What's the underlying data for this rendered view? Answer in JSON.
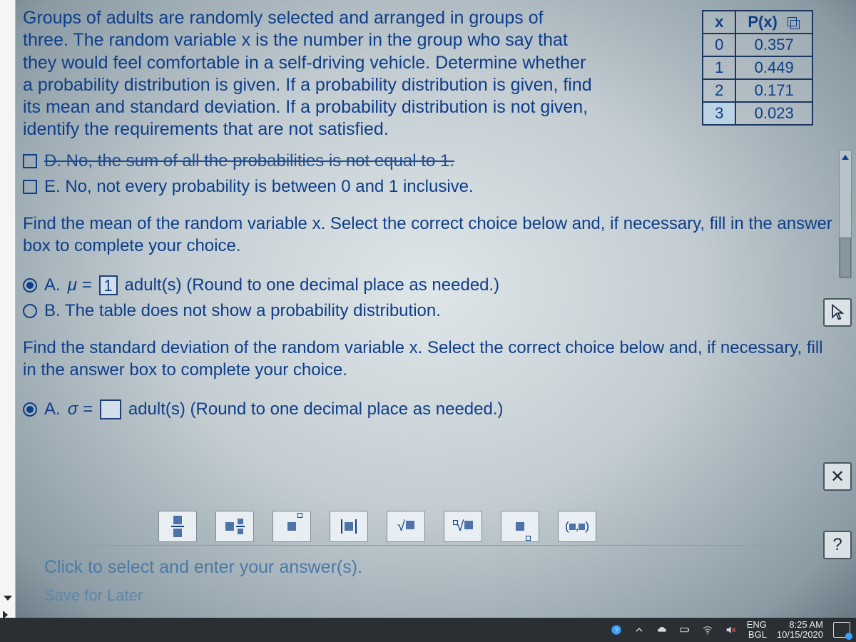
{
  "question": {
    "prompt": "Groups of adults are randomly selected and arranged in groups of three. The random variable x is the number in the group who say that they would feel comfortable in a self-driving vehicle. Determine whether a probability distribution is given. If a probability distribution is given, find its mean and standard deviation. If a probability distribution is not given, identify the requirements that are not satisfied."
  },
  "table": {
    "headers": {
      "x": "x",
      "px": "P(x)"
    },
    "rows": [
      {
        "x": "0",
        "px": "0.357"
      },
      {
        "x": "1",
        "px": "0.449"
      },
      {
        "x": "2",
        "px": "0.171"
      },
      {
        "x": "3",
        "px": "0.023"
      }
    ]
  },
  "options_part1": {
    "d": "D.  No, the sum of all the probabilities is not equal to 1.",
    "e": "E.  No, not every probability is between 0 and 1 inclusive."
  },
  "mean_section": {
    "prompt": "Find the mean of the random variable x. Select the correct choice below and, if necessary, fill in the answer box to complete your choice.",
    "a_prefix": "A.  ",
    "mu": "μ =",
    "a_value": "1",
    "a_suffix": " adult(s) (Round to one decimal place as needed.)",
    "b": "B.  The table does not show a probability distribution."
  },
  "sd_section": {
    "prompt": "Find the standard deviation of the random variable x. Select the correct choice below and, if necessary, fill in the answer box to complete your choice.",
    "a_prefix": "A.  ",
    "sigma": "σ =",
    "a_value": "",
    "a_suffix": " adult(s) (Round to one decimal place as needed.)"
  },
  "math_toolbar": {
    "frac": "▮/▮",
    "mixed": "▮ ▮/▮",
    "exp": "▮▫",
    "abs": "|▮|",
    "sqrt": "√▮",
    "nroot": "▫√▮",
    "sub": "▮▫",
    "coord": "(▮,▮)"
  },
  "footer": {
    "hint": "Click to select and enter your answer(s).",
    "save": "Save for Later"
  },
  "float": {
    "close": "✕",
    "help": "?"
  },
  "taskbar": {
    "lang1": "ENG",
    "lang2": "BGL",
    "time": "8:25 AM",
    "date": "10/15/2020"
  },
  "chart_data": {
    "type": "table",
    "title": "Probability distribution P(x)",
    "columns": [
      "x",
      "P(x)"
    ],
    "rows": [
      [
        0,
        0.357
      ],
      [
        1,
        0.449
      ],
      [
        2,
        0.171
      ],
      [
        3,
        0.023
      ]
    ]
  }
}
